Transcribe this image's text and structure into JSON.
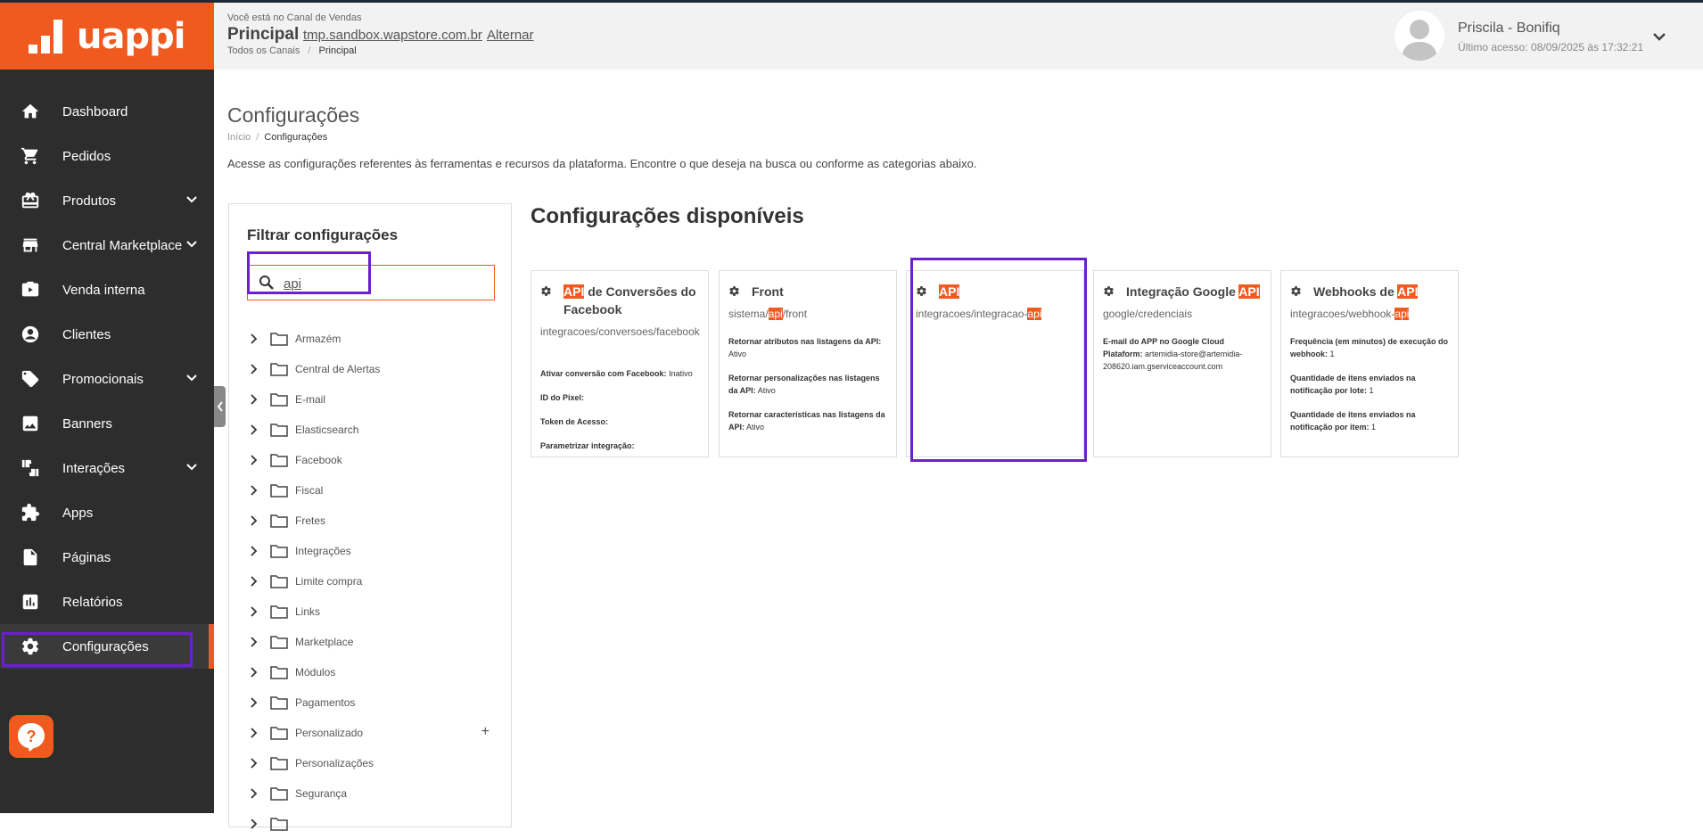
{
  "app": {
    "logo_text": "uappi",
    "brand_color": "#f05a1e",
    "highlight_color": "#6a1fd1"
  },
  "header": {
    "channel_label": "Você está no Canal de Vendas",
    "title": "Principal",
    "store_url": "tmp.sandbox.wapstore.com.br",
    "switch_link": "Alternar",
    "breadcrumb_root": "Todos os Canais",
    "breadcrumb_sep": "/",
    "breadcrumb_current": "Principal"
  },
  "user": {
    "name": "Priscila - Bonifiq",
    "last_access": "Último acesso: 08/09/2025 às 17:32:21"
  },
  "sidebar": {
    "items": [
      {
        "label": "Dashboard",
        "icon": "home-icon"
      },
      {
        "label": "Pedidos",
        "icon": "cart-icon"
      },
      {
        "label": "Produtos",
        "icon": "gift-icon",
        "expandable": true
      },
      {
        "label": "Central Marketplace",
        "icon": "store-icon",
        "expandable": true
      },
      {
        "label": "Venda interna",
        "icon": "video-icon"
      },
      {
        "label": "Clientes",
        "icon": "person-icon"
      },
      {
        "label": "Promocionais",
        "icon": "tag-icon",
        "expandable": true
      },
      {
        "label": "Banners",
        "icon": "image-icon"
      },
      {
        "label": "Interações",
        "icon": "thumbs-icon",
        "expandable": true
      },
      {
        "label": "Apps",
        "icon": "puzzle-icon"
      },
      {
        "label": "Páginas",
        "icon": "page-icon"
      },
      {
        "label": "Relatórios",
        "icon": "chart-icon"
      },
      {
        "label": "Configurações",
        "icon": "gear-icon",
        "active": true
      }
    ]
  },
  "page": {
    "title": "Configurações",
    "crumb_home": "Início",
    "crumb_sep": "/",
    "crumb_current": "Configurações",
    "intro": "Acesse as configurações referentes às ferramentas e recursos da plataforma. Encontre o que deseja na busca ou conforme as categorias abaixo."
  },
  "filter": {
    "title": "Filtrar configurações",
    "search_value": "api",
    "tree": [
      "Armazém",
      "Central de Alertas",
      "E-mail",
      "Elasticsearch",
      "Facebook",
      "Fiscal",
      "Fretes",
      "Integrações",
      "Limite compra",
      "Links",
      "Marketplace",
      "Módulos",
      "Pagamentos",
      "Personalizado",
      "Personalizações",
      "Segurança",
      ""
    ],
    "plus_label": "+"
  },
  "available": {
    "title": "Configurações disponíveis",
    "cards": [
      {
        "title_pre": "",
        "title_mark": "API",
        "title_post": " de Conversões do Facebook",
        "path_pre": "integracoes/conversoes/facebook",
        "path_mark": "",
        "path_post": "",
        "props": [
          {
            "label": "Ativar conversão com Facebook:",
            "value": "Inativo"
          },
          {
            "label": "ID do Pixel:",
            "value": ""
          },
          {
            "label": "Token de Acesso:",
            "value": ""
          },
          {
            "label": "Parametrizar integração:",
            "value": ""
          }
        ]
      },
      {
        "title_pre": "Front",
        "title_mark": "",
        "title_post": "",
        "path_pre": "sistema/",
        "path_mark": "api",
        "path_post": "/front",
        "props": [
          {
            "label": "Retornar atributos nas listagens da API:",
            "value": "Ativo"
          },
          {
            "label": "Retornar personalizações nas listagens da API:",
            "value": "Ativo"
          },
          {
            "label": "Retornar características nas listagens da API:",
            "value": "Ativo"
          }
        ]
      },
      {
        "title_pre": "",
        "title_mark": "API",
        "title_post": "",
        "path_pre": "integracoes/integracao-",
        "path_mark": "api",
        "path_post": "",
        "props": []
      },
      {
        "title_pre": "Integração Google ",
        "title_mark": "API",
        "title_post": "",
        "path_pre": "google/credenciais",
        "path_mark": "",
        "path_post": "",
        "props": [
          {
            "label": "E-mail do APP no Google Cloud Plataform:",
            "value": "artemidia-store@artemidia-208620.iam.gserviceaccount.com"
          }
        ]
      },
      {
        "title_pre": "Webhooks de ",
        "title_mark": "API",
        "title_post": "",
        "path_pre": "integracoes/webhook-",
        "path_mark": "api",
        "path_post": "",
        "props": [
          {
            "label": "Frequência (em minutos) de execução do webhook:",
            "value": "1"
          },
          {
            "label": "Quantidade de itens enviados na notificação por lote:",
            "value": "1"
          },
          {
            "label": "Quantidade de itens enviados na notificação por item:",
            "value": "1"
          }
        ]
      }
    ]
  }
}
